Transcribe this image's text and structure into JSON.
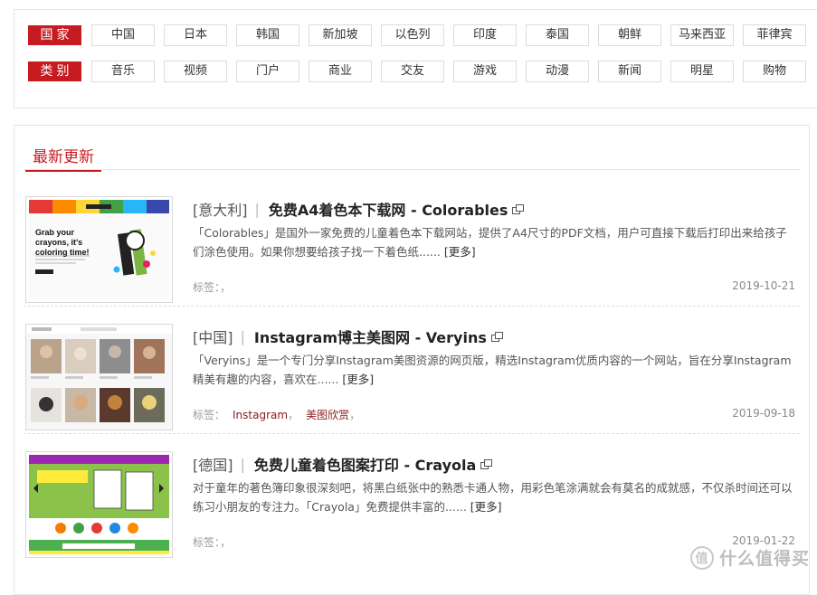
{
  "filters": {
    "country_label": "国家",
    "country_items": [
      "中国",
      "日本",
      "韩国",
      "新加坡",
      "以色列",
      "印度",
      "泰国",
      "朝鲜",
      "马来西亚",
      "菲律宾"
    ],
    "category_label": "类别",
    "category_items": [
      "音乐",
      "视频",
      "门户",
      "商业",
      "交友",
      "游戏",
      "动漫",
      "新闻",
      "明星",
      "购物"
    ]
  },
  "latest": {
    "title": "最新更新",
    "entries": [
      {
        "country": "[意大利]",
        "name": "免费A4着色本下载网 - Colorables",
        "description": "「Colorables」是国外一家免费的儿童着色本下载网站，提供了A4尺寸的PDF文档，用户可直接下载后打印出来给孩子们涂色使用。如果你想要给孩子找一下着色纸......",
        "more": "[更多]",
        "tags_label": "标签：",
        "tags": [],
        "date": "2019-10-21",
        "thumb_text": [
          "Grab your",
          "crayons, it's",
          "coloring time!"
        ]
      },
      {
        "country": "[中国]",
        "name": "Instagram博主美图网 - Veryins",
        "description": "「Veryins」是一个专门分享Instagram美图资源的网页版，精选Instagram优质内容的一个网站，旨在分享Instagram精美有趣的内容，喜欢在......",
        "more": "[更多]",
        "tags_label": "标签：",
        "tags": [
          "Instagram",
          "美图欣赏"
        ],
        "date": "2019-09-18",
        "thumb_text": []
      },
      {
        "country": "[德国]",
        "name": "免费儿童着色图案打印 - Crayola",
        "description": "对于童年的著色簿印象很深刻吧，将黑白纸张中的熟悉卡通人物，用彩色笔涂满就会有莫名的成就感，不仅杀时间还可以练习小朋友的专注力。「Crayola」免费提供丰富的......",
        "more": "[更多]",
        "tags_label": "标签：",
        "tags": [],
        "date": "2019-01-22",
        "thumb_text": []
      }
    ]
  },
  "watermark": {
    "logo_glyph": "值",
    "text": "什么值得买"
  },
  "colors": {
    "accent": "#c71b22",
    "tag": "#8b1a1a",
    "border": "#e6e6e6"
  },
  "icons": {
    "external_link": "external-link-icon"
  }
}
